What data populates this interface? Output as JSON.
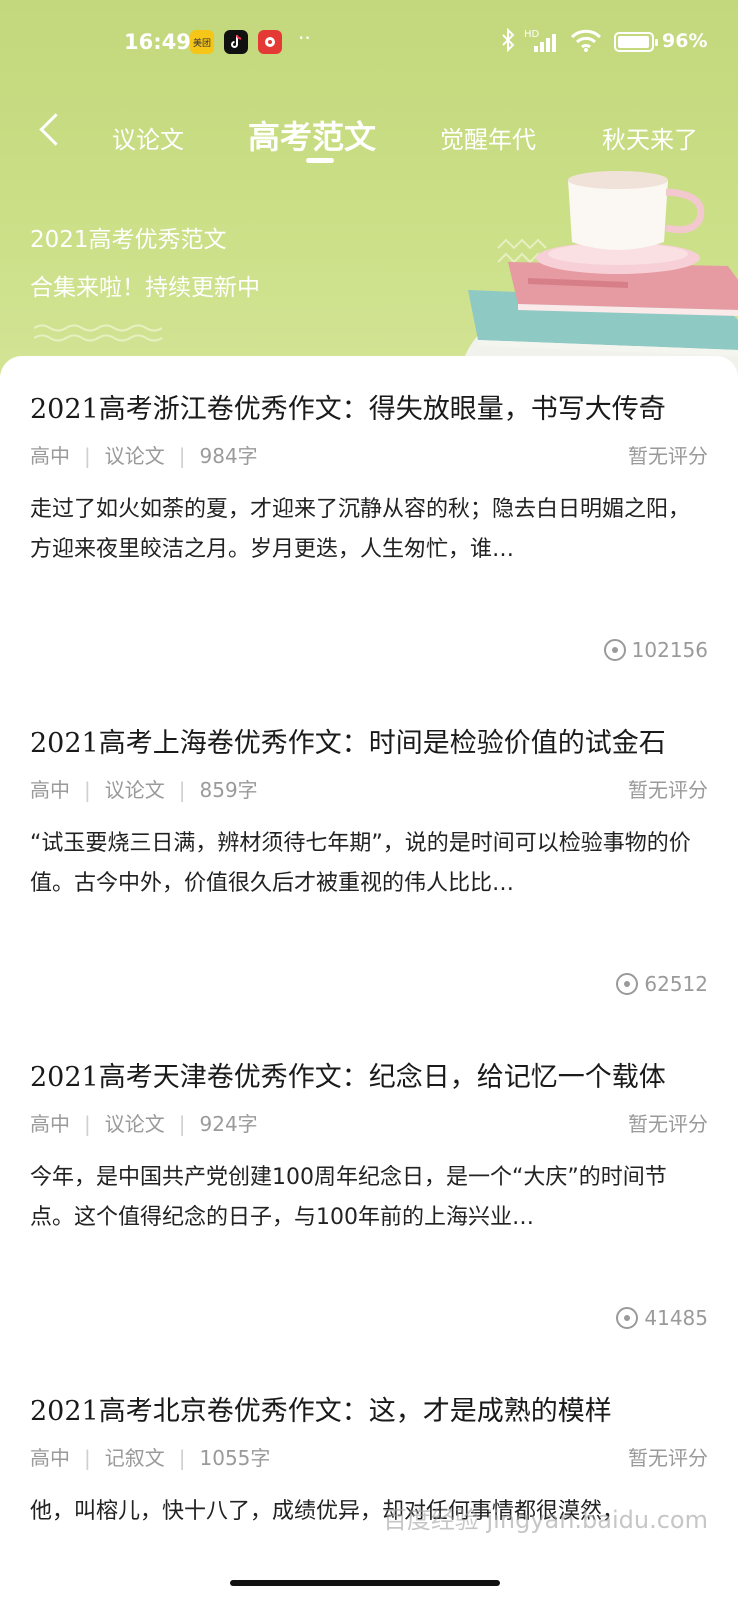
{
  "status_bar": {
    "time": "16:49",
    "app_icons": [
      "美团",
      "tiktok-icon",
      "red-app-icon"
    ],
    "overflow": "··",
    "network_label": "HD",
    "battery": "96%",
    "battery_level": 0.96
  },
  "nav": {
    "back_icon": "chevron-left-icon",
    "tabs": [
      {
        "label": "议论文",
        "active": false
      },
      {
        "label": "高考范文",
        "active": true
      },
      {
        "label": "觉醒年代",
        "active": false
      },
      {
        "label": "秋天来了",
        "active": false
      }
    ]
  },
  "banner": {
    "line1": "2021高考优秀范文",
    "line2": "合集来啦！持续更新中"
  },
  "articles": [
    {
      "title": "2021高考浙江卷优秀作文：得失放眼量，书写大传奇",
      "level": "高中",
      "genre": "议论文",
      "words": "984字",
      "rating": "暂无评分",
      "excerpt": "走过了如火如荼的夏，才迎来了沉静从容的秋；隐去白日明媚之阳，方迎来夜里皎洁之月。岁月更迭，人生匆忙，谁…",
      "views": "102156"
    },
    {
      "title": "2021高考上海卷优秀作文：时间是检验价值的试金石",
      "level": "高中",
      "genre": "议论文",
      "words": "859字",
      "rating": "暂无评分",
      "excerpt": "“试玉要烧三日满，辨材须待七年期”，说的是时间可以检验事物的价值。古今中外，价值很久后才被重视的伟人比比…",
      "views": "62512"
    },
    {
      "title": "2021高考天津卷优秀作文：纪念日，给记忆一个载体",
      "level": "高中",
      "genre": "议论文",
      "words": "924字",
      "rating": "暂无评分",
      "excerpt": "今年，是中国共产党创建100周年纪念日，是一个“大庆”的时间节点。这个值得纪念的日子，与100年前的上海兴业…",
      "views": "41485"
    },
    {
      "title": "2021高考北京卷优秀作文：这，才是成熟的模样",
      "level": "高中",
      "genre": "记叙文",
      "words": "1055字",
      "rating": "暂无评分",
      "excerpt": "他，叫榕儿，快十八了，成绩优异，却对任何事情都很漠然，"
    }
  ],
  "watermark": "百度经验 jingyan.baidu.com",
  "colors": {
    "hero_bg": "#c8dc82",
    "text_muted": "#9a9a9a"
  }
}
